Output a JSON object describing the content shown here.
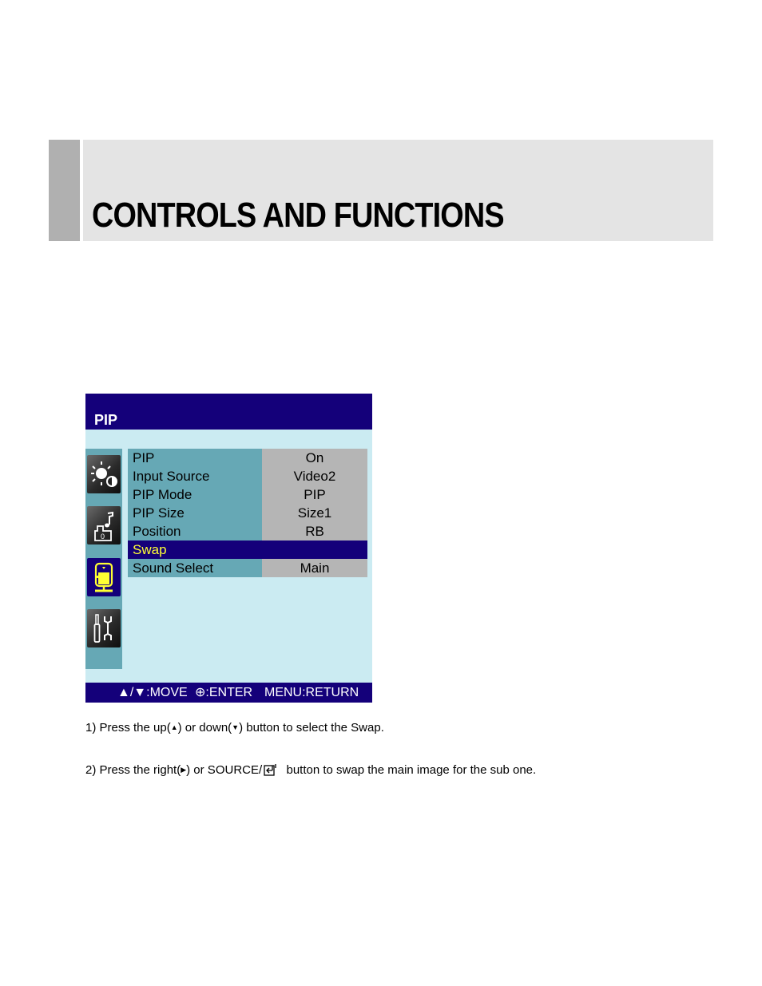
{
  "header": {
    "title": "CONTROLS AND FUNCTIONS"
  },
  "osd": {
    "title": "PIP",
    "sidebar_icons": [
      {
        "name": "picture-icon",
        "active": false
      },
      {
        "name": "sound-icon",
        "active": false
      },
      {
        "name": "pip-icon",
        "active": true
      },
      {
        "name": "setup-tools-icon",
        "active": false
      }
    ],
    "menu": [
      {
        "label": "PIP",
        "value": "On",
        "selected": false
      },
      {
        "label": "Input Source",
        "value": "Video2",
        "selected": false
      },
      {
        "label": "PIP Mode",
        "value": "PIP",
        "selected": false
      },
      {
        "label": "PIP Size",
        "value": "Size1",
        "selected": false
      },
      {
        "label": "Position",
        "value": "RB",
        "selected": false
      },
      {
        "label": "Swap",
        "value": "",
        "selected": true
      },
      {
        "label": "Sound Select",
        "value": "Main",
        "selected": false
      }
    ],
    "footer": {
      "move": "▲/▼:MOVE",
      "enter": "⊕:ENTER",
      "return": "MENU:RETURN"
    }
  },
  "instructions": {
    "step1": {
      "part1": "1) Press the up(",
      "up_glyph": "▲",
      "part2": ") or down(",
      "down_glyph": "▼",
      "part3": ") button to select the Swap."
    },
    "step2": {
      "part1": "2) Press the right(",
      "right_glyph": "▶",
      "part2": ") or SOURCE/",
      "part3": "  button to swap the main image for the sub one."
    }
  }
}
